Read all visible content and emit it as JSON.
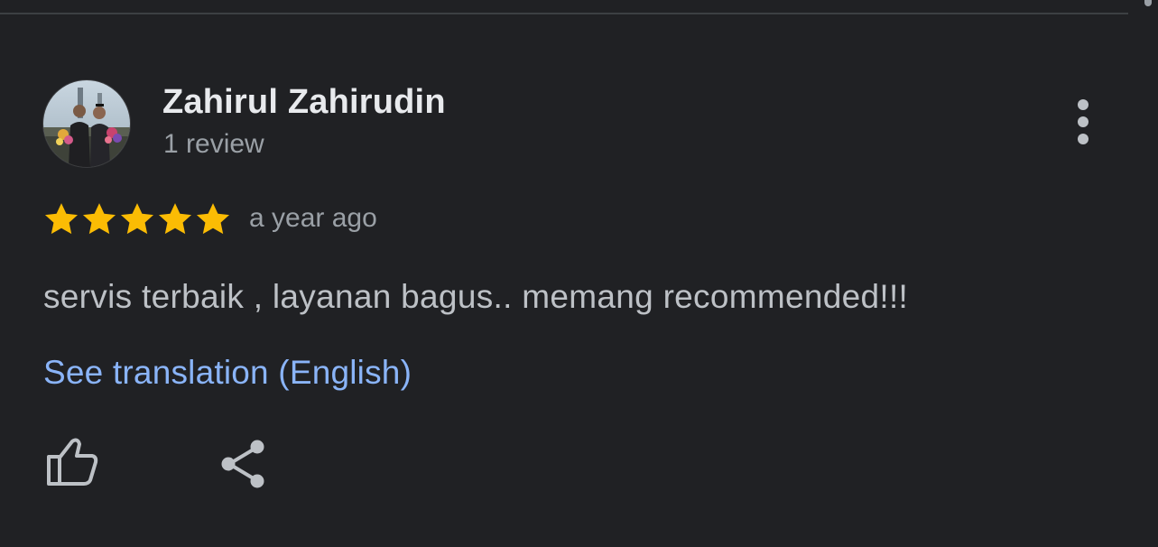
{
  "review": {
    "reviewer_name": "Zahirul Zahirudin",
    "review_count": "1 review",
    "rating": 5,
    "rating_max": 5,
    "time": "a year ago",
    "text": "servis terbaik , layanan bagus.. memang recommended!!!",
    "translate_link": "See translation (English)"
  },
  "icons": {
    "more": "more-vert-icon",
    "like": "thumb-up-icon",
    "share": "share-icon",
    "star": "star-icon"
  },
  "colors": {
    "background": "#202124",
    "name": "#e8eaed",
    "secondary_text": "#9aa0a6",
    "body_text": "#bdc1c6",
    "link": "#8ab4f8",
    "star": "#fbbc04",
    "icon": "#bdc1c6"
  }
}
